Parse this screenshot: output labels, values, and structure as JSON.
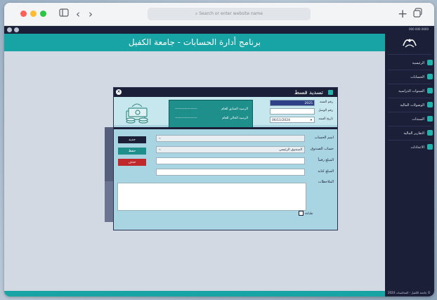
{
  "browser": {
    "url_placeholder": "Search or enter website name",
    "new_tab_icon": "plus-icon",
    "tabs_icon": "tabs-overview-icon"
  },
  "app": {
    "header_title": "برنامج أدارة الحسابات - جامعة الكفيل",
    "user_info": "000 000 0000",
    "footer_text": "جامعة الكفيل - المحاسبات 2024 ©"
  },
  "sidebar": {
    "items": [
      {
        "label": "الرئيسية",
        "icon": "home-icon"
      },
      {
        "label": "الحسابات",
        "icon": "accounts-icon"
      },
      {
        "label": "السنوات الدراسية",
        "icon": "calendar-icon"
      },
      {
        "label": "الوصولات المالية",
        "icon": "receipt-icon"
      },
      {
        "label": "السندات",
        "icon": "document-icon"
      },
      {
        "label": "التقارير المالية",
        "icon": "report-icon"
      },
      {
        "label": "الاعدادات",
        "icon": "settings-icon"
      }
    ]
  },
  "dialog": {
    "title": "تسديد قسط",
    "receipt_no_label": "رقم السند",
    "receipt_no_value": "2025",
    "voucher_no_label": "رقم الوصل",
    "voucher_no_value": "",
    "date_label": "تاريخ السند",
    "date_value": "06/11/2024",
    "balance": {
      "previous_label": "الرصيد السابق للعام",
      "previous_value": "———————",
      "current_label": "الرصيد الحالي للعام",
      "current_value": "———————"
    },
    "fields": {
      "account_name_label": "اسم الحساب",
      "account_name_value": "",
      "cash_box_label": "حساب الصندوق",
      "cash_box_value": "الصندوق الرئيسي",
      "amount_label": "المبلغ رقماً",
      "amount_value": "",
      "amount_words_label": "المبلغ كتابة",
      "amount_words_value": "",
      "notes_label": "الملاحظات",
      "notes_value": ""
    },
    "buttons": {
      "new": "جديد",
      "save": "حفظ",
      "delete": "حذف"
    },
    "checkbox_label": "طباعة"
  }
}
